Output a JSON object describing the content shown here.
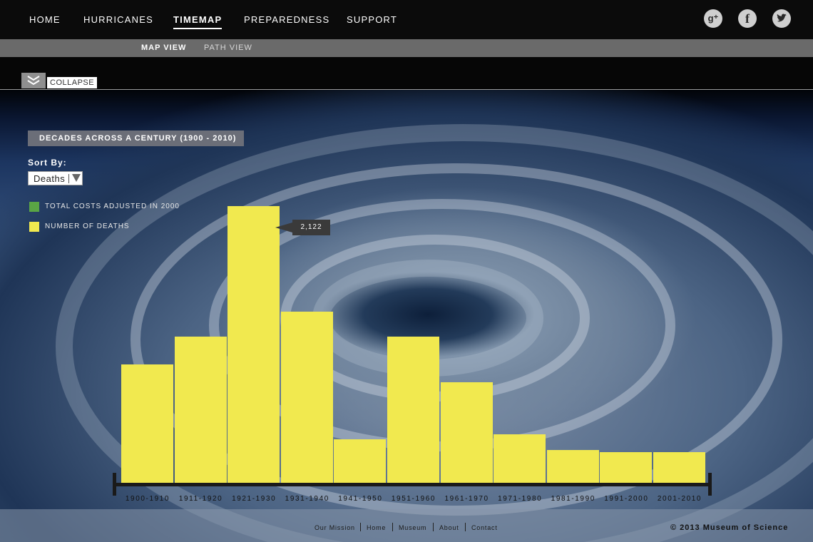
{
  "nav": {
    "items": [
      {
        "label": "HOME"
      },
      {
        "label": "HURRICANES"
      },
      {
        "label": "TIMEMAP",
        "active": true
      },
      {
        "label": "PREPAREDNESS"
      },
      {
        "label": "SUPPORT"
      }
    ],
    "social": [
      {
        "icon": "google-plus-icon",
        "glyph": "g⁺"
      },
      {
        "icon": "facebook-icon",
        "glyph": "f"
      },
      {
        "icon": "twitter-icon",
        "glyph": "t"
      }
    ]
  },
  "subnav": {
    "items": [
      {
        "label": "MAP VIEW",
        "active": true
      },
      {
        "label": "PATH VIEW"
      }
    ]
  },
  "collapse": {
    "label": "COLLAPSE"
  },
  "panel": {
    "title": "DECADES ACROSS A CENTURY  (1900 - 2010)",
    "sort_label": "Sort By:",
    "sort_value": "Deaths",
    "legend": [
      {
        "label": "TOTAL COSTS ADJUSTED IN 2000",
        "color": "#5aa545"
      },
      {
        "label": "NUMBER OF DEATHS",
        "color": "#f1e94f"
      }
    ]
  },
  "chart_data": {
    "type": "bar",
    "categories": [
      "1900-1910",
      "1911-1920",
      "1921-1930",
      "1931-1940",
      "1941-1950",
      "1951-1960",
      "1961-1970",
      "1971-1980",
      "1981-1990",
      "1991-2000",
      "2001-2010"
    ],
    "values": [
      910,
      1120,
      2122,
      1315,
      335,
      1120,
      770,
      370,
      250,
      235,
      235
    ],
    "ylim": [
      0,
      2122
    ],
    "bar_color": "#f1e94f",
    "tooltip": {
      "category_index": 2,
      "label": "2,122"
    }
  },
  "footer": {
    "links": [
      "Our Mission",
      "Home",
      "Museum",
      "About",
      "Contact"
    ],
    "copyright": "©  2013 Museum of Science"
  }
}
